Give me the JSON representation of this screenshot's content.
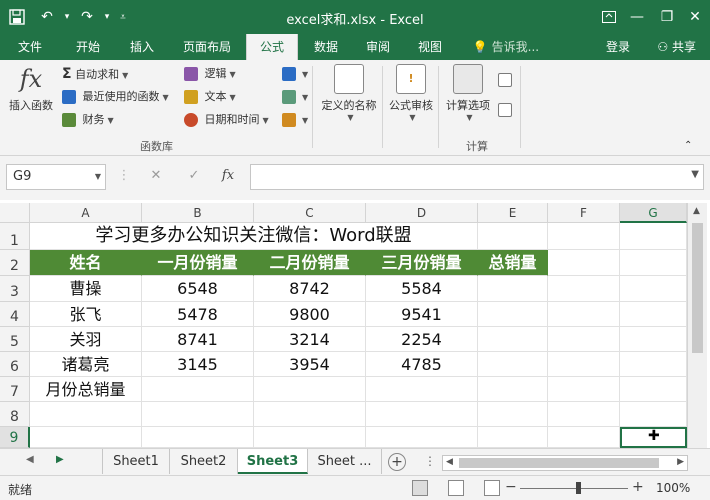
{
  "window": {
    "title": "excel求和.xlsx - Excel"
  },
  "ribbon_tabs": [
    "文件",
    "开始",
    "插入",
    "页面布局",
    "公式",
    "数据",
    "审阅",
    "视图"
  ],
  "tell_me": "告诉我...",
  "login": "登录",
  "share": "共享",
  "ribbon": {
    "insert_function": "插入函数",
    "autosum": "自动求和",
    "recent": "最近使用的函数",
    "financial": "财务",
    "logical": "逻辑",
    "text": "文本",
    "datetime": "日期和时间",
    "function_library": "函数库",
    "defined_names": "定义的名称",
    "formula_auditing": "公式审核",
    "calc_options": "计算选项",
    "calculation": "计算"
  },
  "formula_bar": {
    "name_box": "G9",
    "fx": "fx",
    "formula": ""
  },
  "columns": [
    "A",
    "B",
    "C",
    "D",
    "E",
    "F",
    "G"
  ],
  "rows": [
    "1",
    "2",
    "3",
    "4",
    "5",
    "6",
    "7",
    "8",
    "9"
  ],
  "sheet": {
    "title": "学习更多办公知识关注微信：Word联盟",
    "headers": [
      "姓名",
      "一月份销量",
      "二月份销量",
      "三月份销量",
      "总销量"
    ],
    "data": [
      [
        "曹操",
        "6548",
        "8742",
        "5584",
        ""
      ],
      [
        "张飞",
        "5478",
        "9800",
        "9541",
        ""
      ],
      [
        "关羽",
        "8741",
        "3214",
        "2254",
        ""
      ],
      [
        "诸葛亮",
        "3145",
        "3954",
        "4785",
        ""
      ]
    ],
    "total_label": "月份总销量"
  },
  "sheet_tabs": [
    "Sheet1",
    "Sheet2",
    "Sheet3",
    "Sheet ..."
  ],
  "active_sheet": "Sheet3",
  "status": {
    "ready": "就绪",
    "zoom": "100%"
  },
  "colors": {
    "accent": "#217346",
    "header_fill": "#4f8a35"
  }
}
